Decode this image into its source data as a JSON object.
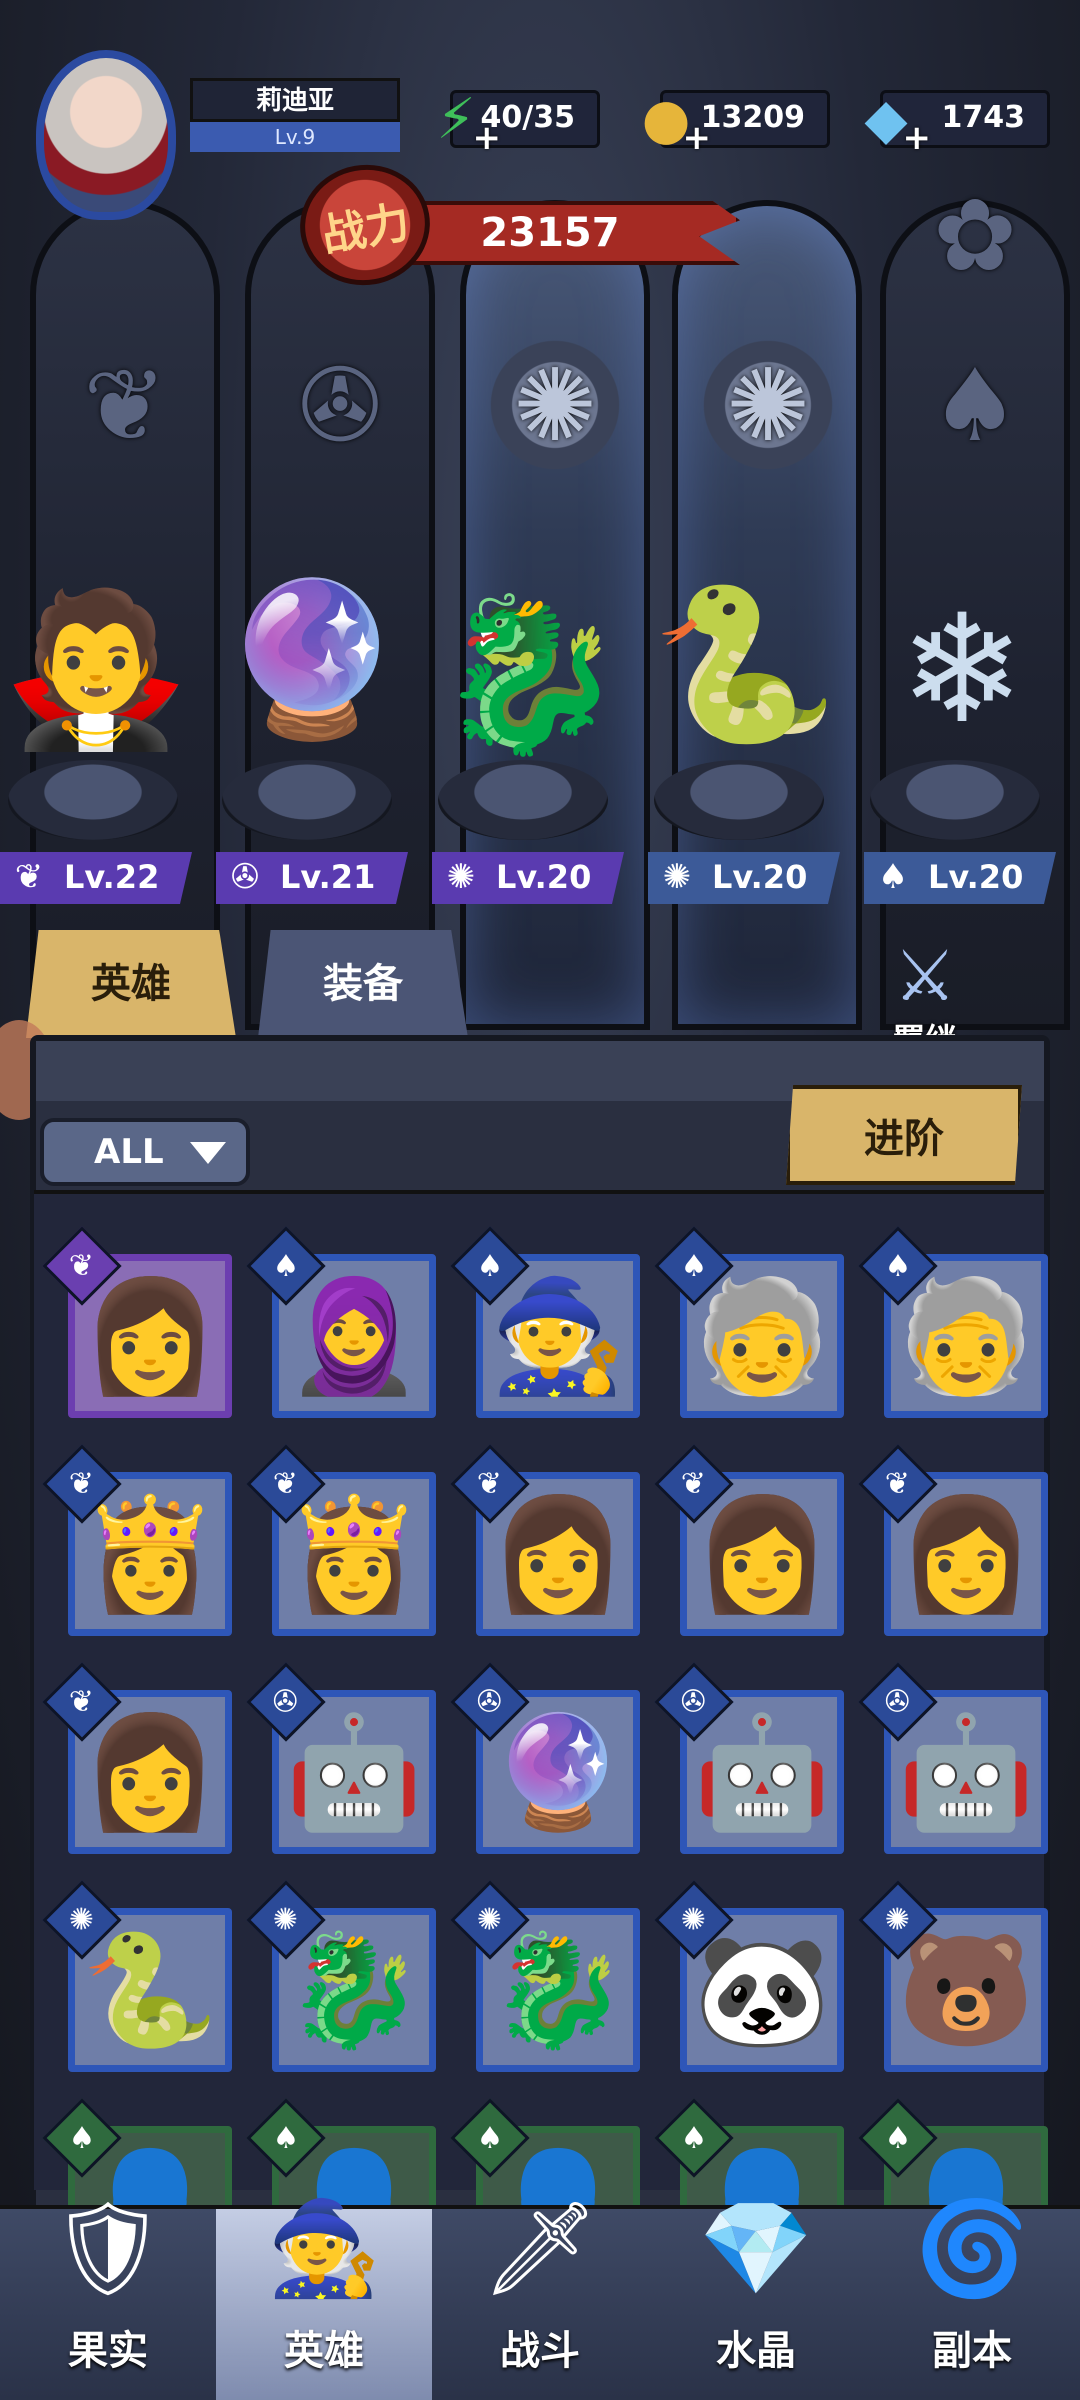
{
  "player": {
    "name": "莉迪亚",
    "level": "Lv.9"
  },
  "resources": {
    "energy": {
      "value": "40/35",
      "icon": "lightning-icon",
      "color": "#3fbf5a"
    },
    "gold": {
      "value": "13209",
      "icon": "coin-icon",
      "color": "#e6b53a"
    },
    "diamond": {
      "value": "1743",
      "icon": "diamond-icon",
      "color": "#6fc2f0"
    }
  },
  "power": {
    "label": "战力",
    "value": "23157"
  },
  "emblems": [
    "wing-emblem-icon",
    "wrench-emblem-icon",
    "beast-emblem-icon",
    "beast-emblem-icon",
    "flower-emblem-icon"
  ],
  "lineup": [
    {
      "level": "Lv.22",
      "class_icon": "wing-icon",
      "tag_color": "#5a3bb0",
      "figure": "vampire-hero"
    },
    {
      "level": "Lv.21",
      "class_icon": "wrench-icon",
      "tag_color": "#5a3bb0",
      "figure": "crystal-pod-hero"
    },
    {
      "level": "Lv.20",
      "class_icon": "beast-icon",
      "tag_color": "#5a3bb0",
      "figure": "dragon-knight-hero"
    },
    {
      "level": "Lv.20",
      "class_icon": "beast-icon",
      "tag_color": "#3c5a98",
      "figure": "medusa-hero"
    },
    {
      "level": "Lv.20",
      "class_icon": "flame-icon",
      "tag_color": "#3c5a98",
      "figure": "ice-mage-hero"
    }
  ],
  "tabs": {
    "heroes": "英雄",
    "equipment": "装备"
  },
  "bond_label": "羁绊",
  "filter_label": "ALL",
  "advance_label": "进阶",
  "roster": [
    [
      {
        "badge": "wing",
        "rarity": "purple"
      },
      {
        "badge": "flame",
        "rarity": "blue"
      },
      {
        "badge": "flame",
        "rarity": "blue"
      },
      {
        "badge": "flame",
        "rarity": "blue"
      },
      {
        "badge": "flame",
        "rarity": "blue"
      }
    ],
    [
      {
        "badge": "wing",
        "rarity": "blue"
      },
      {
        "badge": "wing",
        "rarity": "blue"
      },
      {
        "badge": "wing",
        "rarity": "blue"
      },
      {
        "badge": "wing",
        "rarity": "blue"
      },
      {
        "badge": "wing",
        "rarity": "blue"
      }
    ],
    [
      {
        "badge": "wing",
        "rarity": "blue"
      },
      {
        "badge": "wrench",
        "rarity": "blue"
      },
      {
        "badge": "wrench",
        "rarity": "blue"
      },
      {
        "badge": "wrench",
        "rarity": "blue"
      },
      {
        "badge": "wrench",
        "rarity": "blue"
      }
    ],
    [
      {
        "badge": "beast",
        "rarity": "blue"
      },
      {
        "badge": "beast",
        "rarity": "blue"
      },
      {
        "badge": "beast",
        "rarity": "blue"
      },
      {
        "badge": "beast",
        "rarity": "blue"
      },
      {
        "badge": "beast",
        "rarity": "blue"
      }
    ],
    [
      {
        "badge": "flame",
        "rarity": "green"
      },
      {
        "badge": "flame",
        "rarity": "green"
      },
      {
        "badge": "flame",
        "rarity": "green"
      },
      {
        "badge": "flame",
        "rarity": "green"
      },
      {
        "badge": "flame",
        "rarity": "green"
      }
    ]
  ],
  "nav": [
    {
      "label": "果实",
      "icon": "fruit-icon"
    },
    {
      "label": "英雄",
      "icon": "hero-hat-icon",
      "active": true
    },
    {
      "label": "战斗",
      "icon": "sword-icon"
    },
    {
      "label": "水晶",
      "icon": "crystal-icon"
    },
    {
      "label": "副本",
      "icon": "portal-icon"
    }
  ]
}
